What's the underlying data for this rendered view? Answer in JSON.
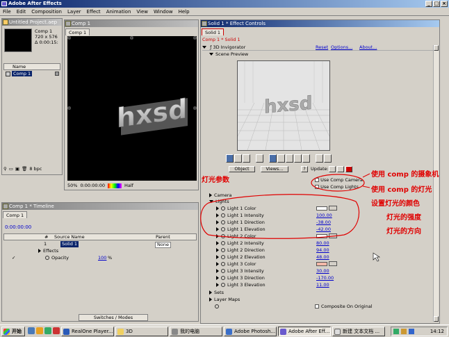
{
  "app_title": "Adobe After Effects",
  "menu": [
    "File",
    "Edit",
    "Composition",
    "Layer",
    "Effect",
    "Animation",
    "View",
    "Window",
    "Help"
  ],
  "project": {
    "title": "Untitled Project.aep",
    "comp_name": "Comp 1",
    "comp_size": "720 x 576",
    "comp_duration": "Δ 0:00:15:",
    "col_name": "Name",
    "item": "Comp 1",
    "bpc": "8 bpc"
  },
  "comp_window": {
    "title": "Comp 1",
    "tab": "Comp 1",
    "zoom": "50%",
    "timecode": "0:00:00:00",
    "resolution": "Half"
  },
  "timeline": {
    "title": "Comp 1 * Timeline",
    "tab": "Comp 1",
    "timecode": "0:00:00:00",
    "col_num": "#",
    "col_source": "Source Name",
    "col_parent": "Parent",
    "layer_num": "1",
    "layer_name": "Solid 1",
    "parent_value": "None",
    "effects_label": "Effects",
    "opacity_label": "Opacity",
    "opacity_value": "100",
    "opacity_unit": "%",
    "footer": "Switches / Modes"
  },
  "effect_controls": {
    "title": "Solid 1 * Effect Controls",
    "tab": "Solid 1",
    "breadcrumb": "Comp 1 * Solid 1",
    "effect_name": "3D Invigorator",
    "reset": "Reset",
    "options": "Options...",
    "about": "About...",
    "scene_preview": "Scene Preview",
    "object_dd": "Object",
    "views_dd": "Views...",
    "help_btn": "?",
    "update_label": "Update:",
    "use_comp_camera": "Use Comp Camera",
    "use_comp_lights": "Use Comp Lights",
    "camera": "Camera",
    "lights": "Lights",
    "light_rows": [
      {
        "label": "Light 1 Color",
        "value": ""
      },
      {
        "label": "Light 1 Intensity",
        "value": "100.00"
      },
      {
        "label": "Light 1 Direction",
        "value": "-38.00"
      },
      {
        "label": "Light 1 Elevation",
        "value": "-42.00"
      },
      {
        "label": "Light 2 Color",
        "value": ""
      },
      {
        "label": "Light 2 Intensity",
        "value": "80.00"
      },
      {
        "label": "Light 2 Direction",
        "value": "94.00"
      },
      {
        "label": "Light 2 Elevation",
        "value": "48.00"
      },
      {
        "label": "Light 3 Color",
        "value": ""
      },
      {
        "label": "Light 3 Intensity",
        "value": "30.00"
      },
      {
        "label": "Light 3 Direction",
        "value": "-170.00"
      },
      {
        "label": "Light 3 Elevation",
        "value": "11.00"
      }
    ],
    "sets": "Sets",
    "layer_maps": "Layer Maps",
    "composite_on_original": "Composite On Original",
    "preview_text": "hxsd"
  },
  "annotations": {
    "light_params": "灯光参数",
    "use_comp_camera": "使用 comp 的摄象机",
    "use_comp_lights": "使用 comp 的灯光",
    "light_color": "设置灯光的颜色",
    "light_intensity": "灯光的强度",
    "light_direction": "灯光的方向"
  },
  "taskbar": {
    "start": "开始",
    "items": [
      "RealOne Player...",
      "3D",
      "我的电脑",
      "Adobe Photosh...",
      "Adobe After Eff...",
      "新建 文本文档 ..."
    ],
    "clock": "14:12"
  },
  "colors": {
    "title_active": "#0a246a",
    "annotation": "#e00000",
    "value_link": "#0000cc",
    "light1_color": "#ffffff",
    "light2_color": "#ffffff",
    "light3_color": "#f4b8a8"
  }
}
